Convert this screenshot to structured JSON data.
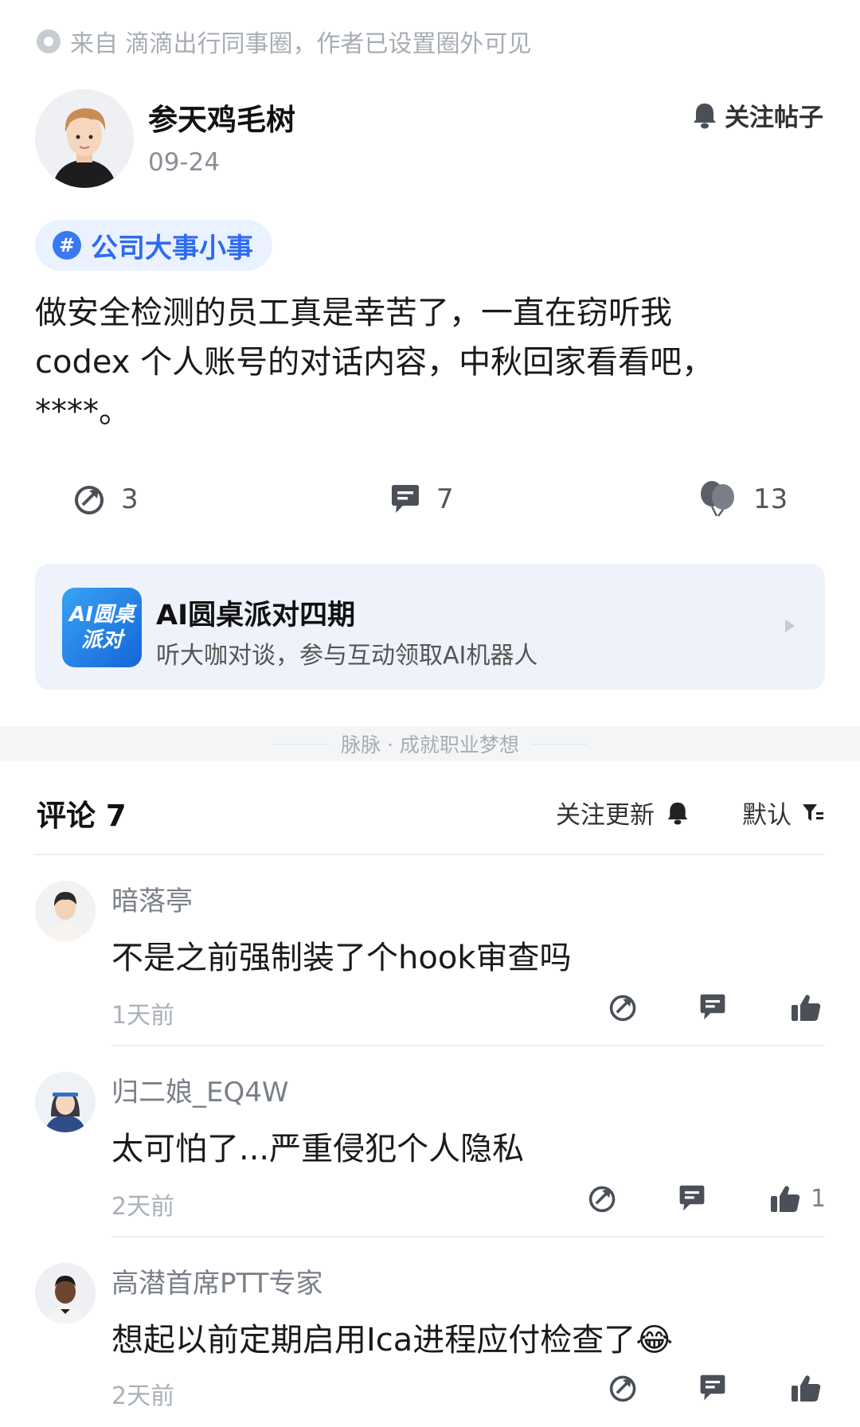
{
  "source": {
    "prefix": "来自",
    "text": "滴滴出行同事圈，作者已设置圈外可见"
  },
  "author": {
    "name": "参天鸡毛树",
    "date": "09-24",
    "follow_label": "关注帖子"
  },
  "topic": {
    "hash": "#",
    "label": "公司大事小事"
  },
  "post": {
    "line1": "做安全检测的员工真是幸苦了，一直在窃听我",
    "line2": "codex 个人账号的对话内容，中秋回家看看吧，",
    "line3": "****。"
  },
  "stats": {
    "shares": "3",
    "comments": "7",
    "likes": "13"
  },
  "promo": {
    "logo_line1": "AI圆桌",
    "logo_line2": "派对",
    "title": "AI圆桌派对四期",
    "subtitle": "听大咖对谈，参与互动领取AI机器人"
  },
  "brand": {
    "tagline": "脉脉 · 成就职业梦想"
  },
  "comments_header": {
    "title": "评论 7",
    "follow_updates": "关注更新",
    "sort": "默认"
  },
  "comments": [
    {
      "name": "暗落亭",
      "text": "不是之前强制装了个hook审查吗",
      "time": "1天前",
      "likes": ""
    },
    {
      "name": "归二娘_EQ4W",
      "text": "太可怕了...严重侵犯个人隐私",
      "time": "2天前",
      "likes": "1"
    },
    {
      "name": "高潜首席PTT专家",
      "text": "想起以前定期启用Ica进程应付检查了",
      "emoji": "😂",
      "time": "2天前",
      "likes": ""
    }
  ],
  "colors": {
    "accent": "#2d6bf0",
    "chip_bg": "#ebf2ff",
    "promo_bg": "#eef3fb",
    "muted": "#a8adb5",
    "icon_gray": "#4a4f58"
  }
}
